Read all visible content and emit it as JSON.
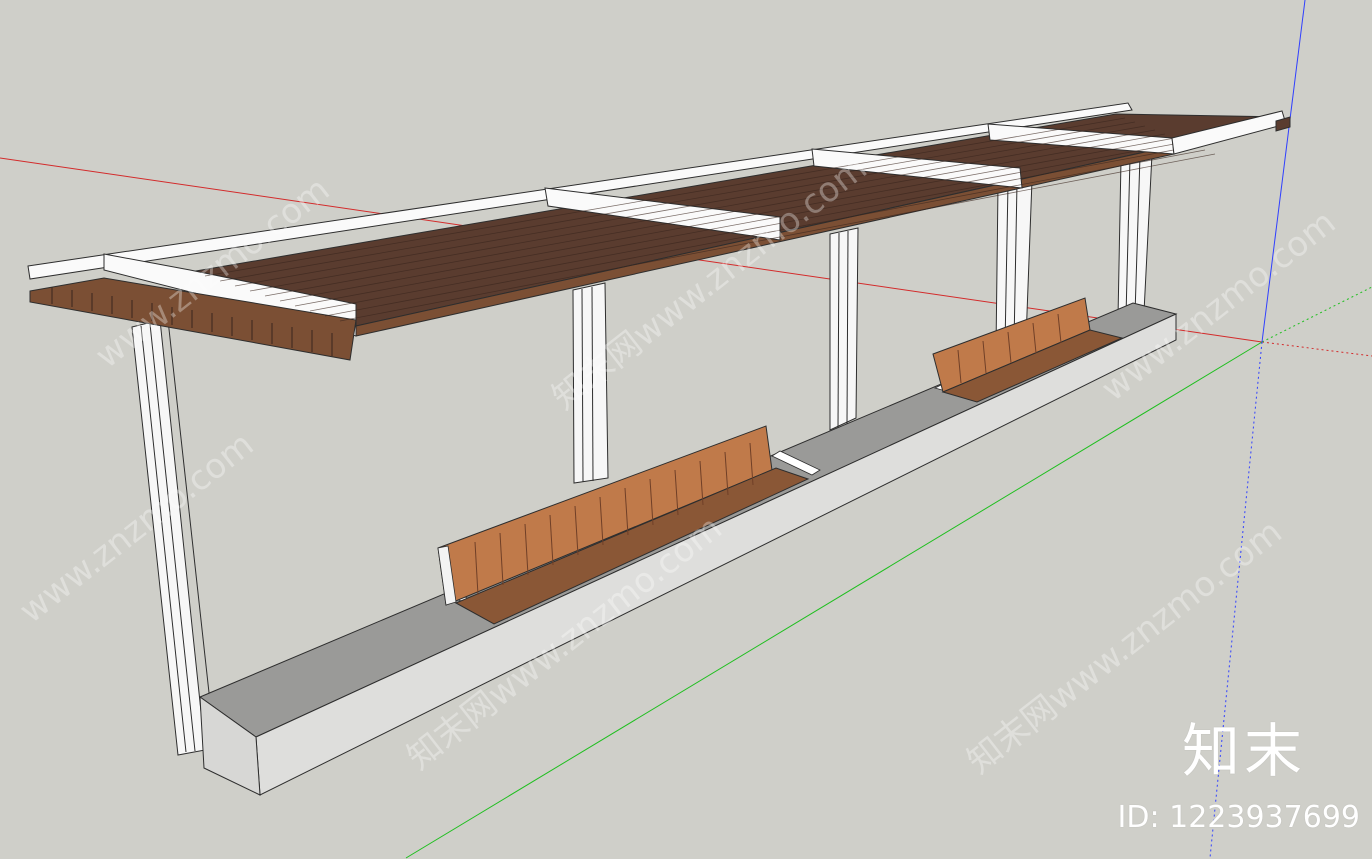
{
  "brand": {
    "logo_text": "知末",
    "id_label": "ID: 1223937699"
  },
  "watermarks": [
    "www.znzmo.com",
    "知末网www.znzmo.com"
  ],
  "axes": {
    "red": "#d32b2b",
    "green": "#1fbf1f",
    "blue": "#2f3fff"
  },
  "materials": {
    "wood_dark": "#5a3c2f",
    "wood_mid": "#7b4f34",
    "wood_light": "#b5704a",
    "concrete_top": "#9c9c9a",
    "concrete_side": "#dcdcdc",
    "frame": "#fafafa",
    "outline": "#2e2e2e"
  }
}
